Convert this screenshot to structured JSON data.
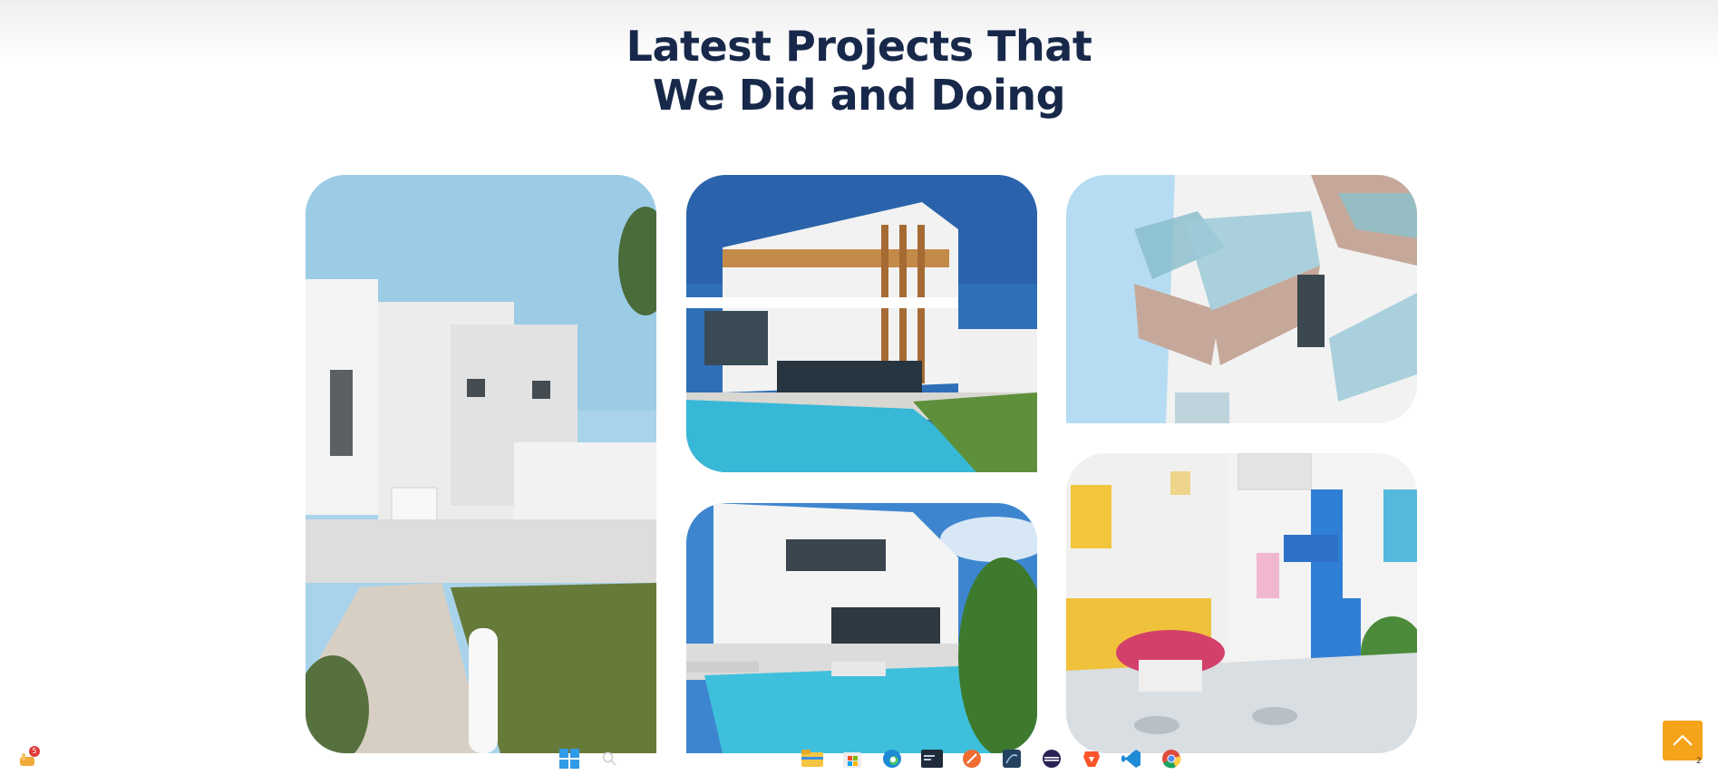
{
  "section": {
    "title_line1": "Latest Projects That",
    "title_line2": "We Did and Doing"
  },
  "gallery": {
    "projects": [
      {
        "name": "white-villa-walkway"
      },
      {
        "name": "modern-villa-pool"
      },
      {
        "name": "white-house-pool-palms"
      },
      {
        "name": "apartment-glass-balconies"
      },
      {
        "name": "colorful-courtyard"
      }
    ]
  },
  "colors": {
    "title": "#17284a",
    "accent": "#f5a31a",
    "sky": "#9ccbe6",
    "pool": "#37b8d6"
  },
  "scroll_top": {
    "icon": "chevron-up-icon"
  },
  "taskbar": {
    "tray_badge": "5",
    "tray_count": "2",
    "icons": [
      "windows-start-icon",
      "search-icon",
      "file-explorer-icon",
      "microsoft-store-icon",
      "edge-browser-icon",
      "terminal-icon",
      "postman-icon",
      "mysql-workbench-icon",
      "eclipse-icon",
      "brave-browser-icon",
      "vscode-icon",
      "chrome-browser-icon"
    ]
  }
}
